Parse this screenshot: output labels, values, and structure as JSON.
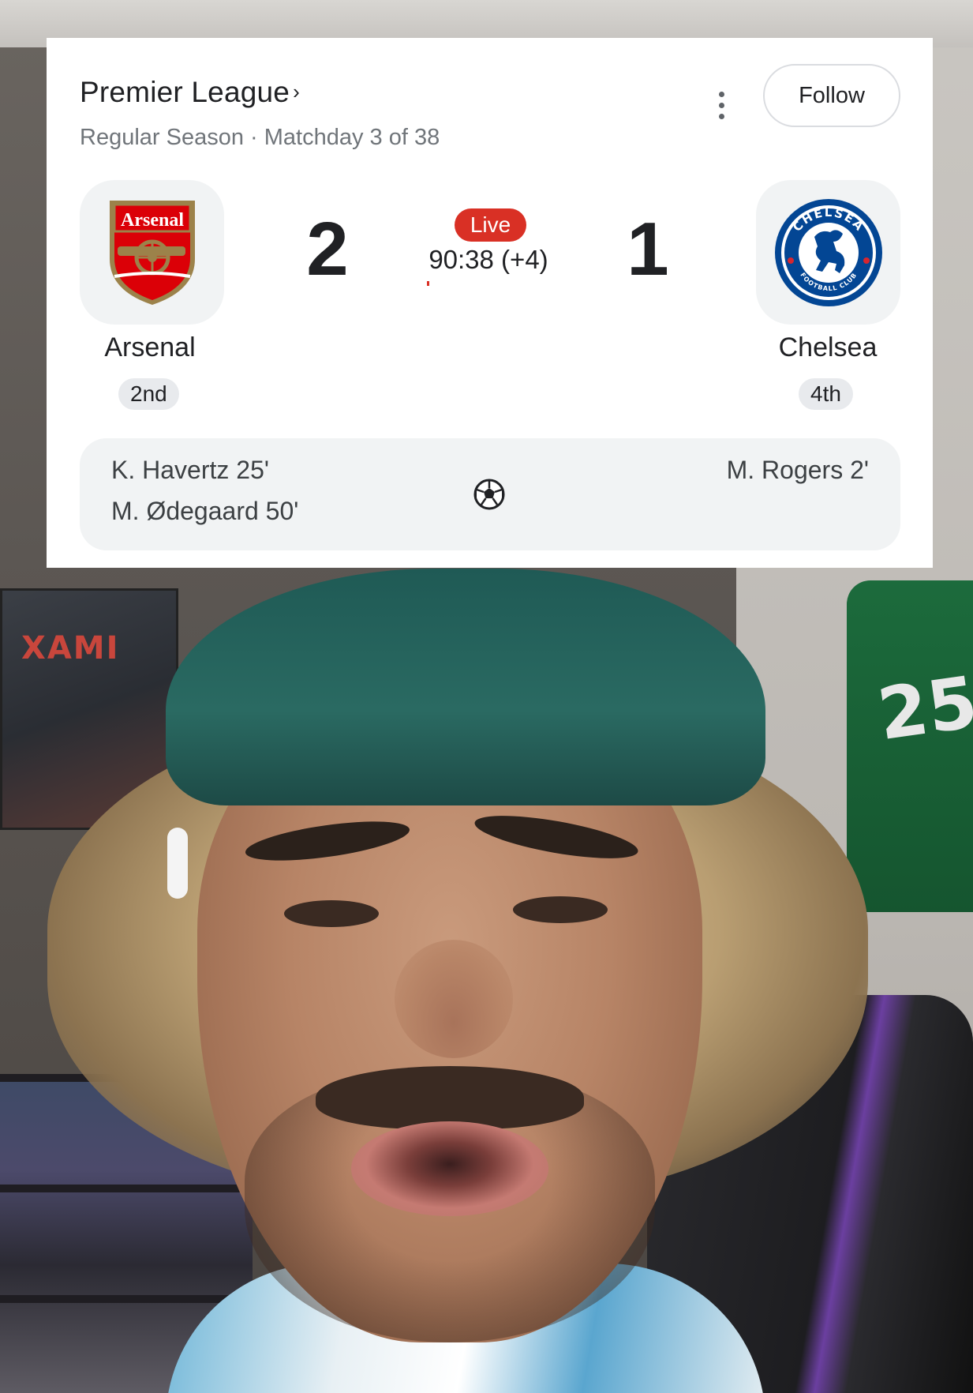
{
  "card": {
    "league": "Premier League",
    "league_chevron": "›",
    "subtitle": "Regular Season · Matchday 3 of 38",
    "more_icon": "more-vert-icon",
    "follow_label": "Follow"
  },
  "match": {
    "status": "Live",
    "clock": "90:38 (+4)",
    "home": {
      "name": "Arsenal",
      "score": "2",
      "rank": "2nd",
      "crest_text": "Arsenal",
      "crest_icon": "arsenal-crest-icon"
    },
    "away": {
      "name": "Chelsea",
      "score": "1",
      "rank": "4th",
      "crest_text": "CHELSEA",
      "crest_subtext": "FOOTBALL CLUB",
      "crest_icon": "chelsea-crest-icon"
    },
    "scorers": {
      "home": [
        "K. Havertz 25'",
        "M. Ødegaard 50'"
      ],
      "away": [
        "M. Rogers 2'"
      ],
      "icon": "soccer-ball-icon"
    }
  },
  "colors": {
    "live_red": "#d93025",
    "arsenal_red": "#db0007",
    "chelsea_blue": "#034694"
  }
}
